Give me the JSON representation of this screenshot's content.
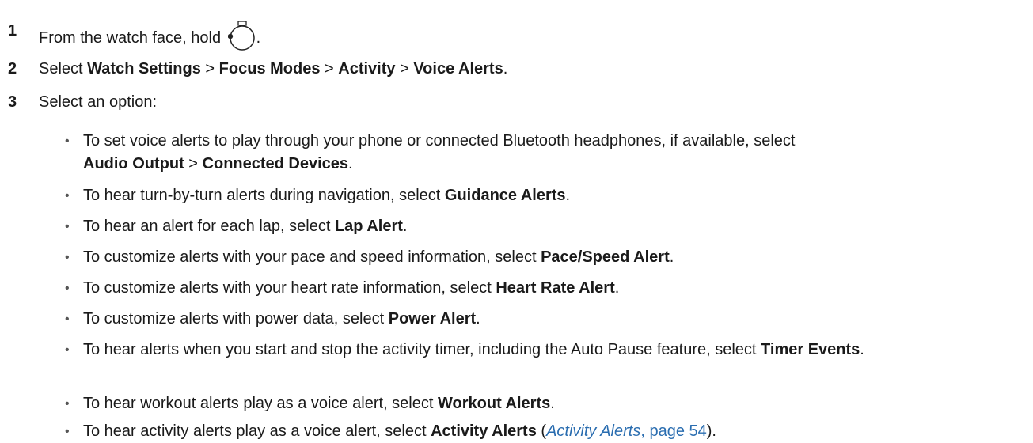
{
  "steps": [
    {
      "num": "1",
      "text_before": "From the watch face, hold",
      "icon": "watch-button-icon",
      "text_after": "."
    },
    {
      "num": "2",
      "text_before": "Select ",
      "items": [
        "Watch Settings",
        "Focus Modes",
        "Activity",
        "Voice Alerts"
      ],
      "sep": " > ",
      "text_after": "."
    },
    {
      "num": "3",
      "text": "Select an option:"
    }
  ],
  "options": [
    {
      "pre": "To set voice alerts to play through your phone or connected Bluetooth headphones, if available, select",
      "bold1": "Audio Output",
      "sep": " > ",
      "bold2": "Connected Devices",
      "post": "."
    },
    {
      "pre": "To hear turn-by-turn alerts during navigation, select ",
      "bold": "Guidance Alerts",
      "post": "."
    },
    {
      "pre": "To hear an alert for each lap, select ",
      "bold": "Lap Alert",
      "post": "."
    },
    {
      "pre": "To customize alerts with your pace and speed information, select ",
      "bold": "Pace/Speed Alert",
      "post": "."
    },
    {
      "pre": "To customize alerts with your heart rate information, select ",
      "bold": "Heart Rate Alert",
      "post": "."
    },
    {
      "pre": "To customize alerts with power data, select ",
      "bold": "Power Alert",
      "post": "."
    },
    {
      "pre": "To hear alerts when you start and stop the activity timer, including the Auto Pause feature, select",
      "bold": "Timer Events",
      "post": "."
    },
    {
      "pre": "To hear workout alerts play as a voice alert, select ",
      "bold": "Workout Alerts",
      "post": "."
    },
    {
      "pre": "To hear activity alerts play as a voice alert, select ",
      "bold": "Activity Alerts",
      "mid": " (",
      "link": "Activity Alerts",
      "link_suffix": ", page 54",
      "post": ")."
    }
  ],
  "bullet_char": "•"
}
